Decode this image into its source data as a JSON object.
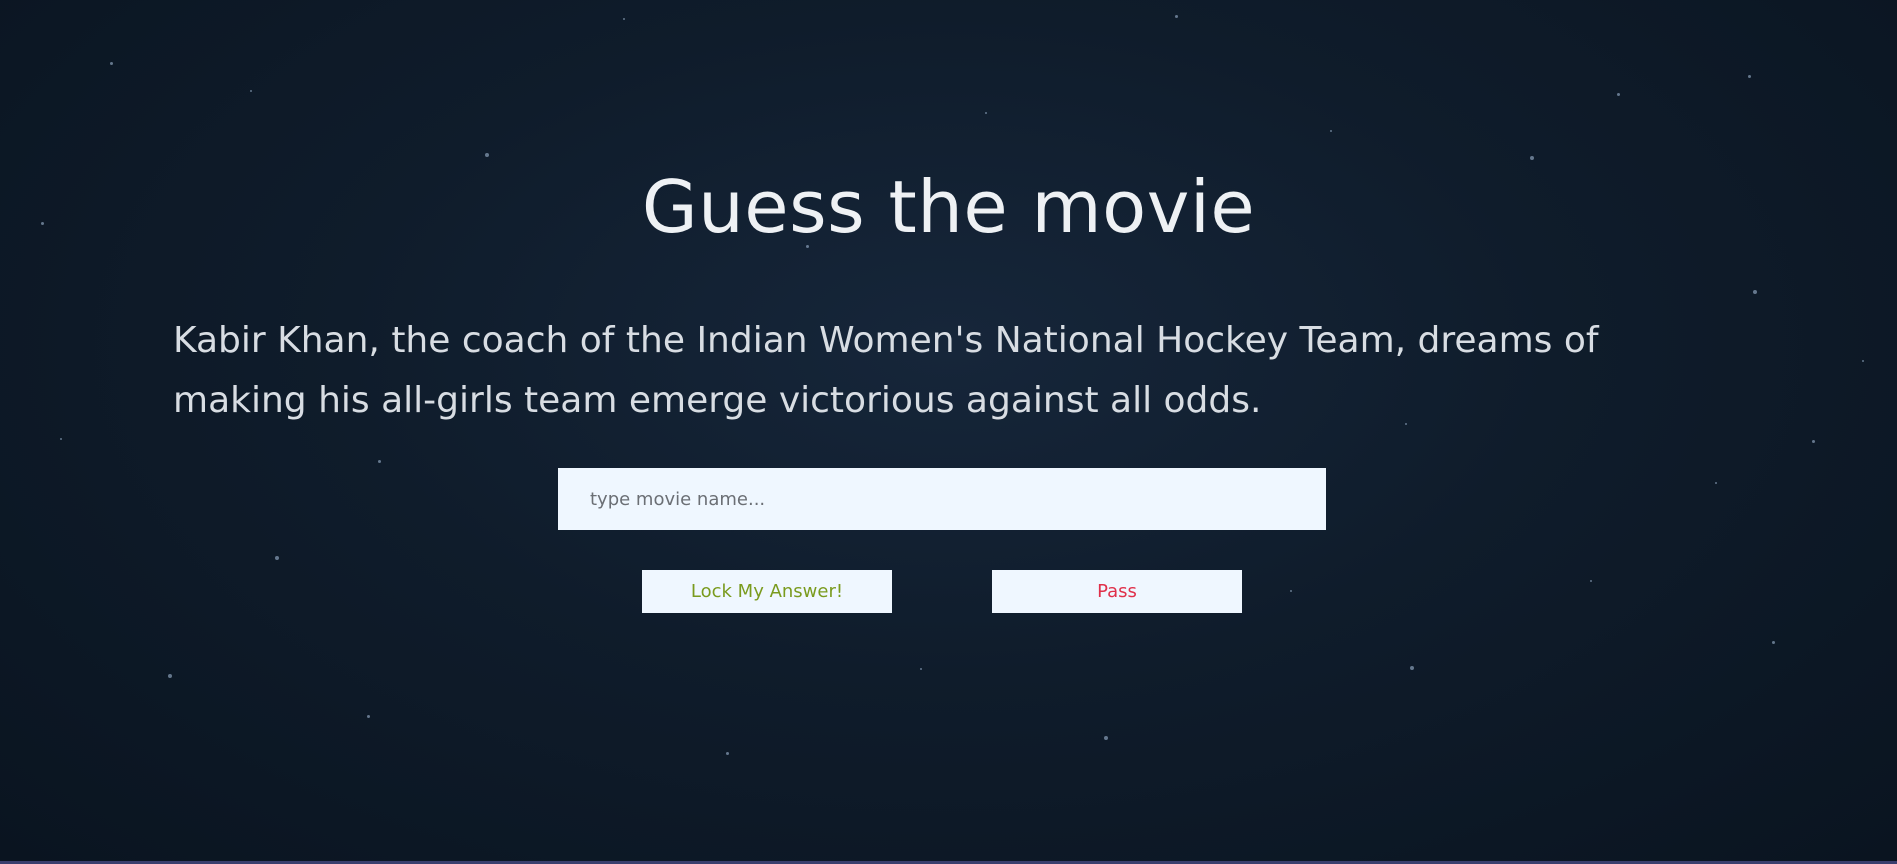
{
  "title": "Guess the movie",
  "clue": "Kabir Khan, the coach of the Indian Women's National Hockey Team, dreams of making his all-girls team emerge victorious against all odds.",
  "answer_input": {
    "value": "",
    "placeholder": "type movie name..."
  },
  "buttons": {
    "lock_label": "Lock My Answer!",
    "pass_label": "Pass"
  },
  "colors": {
    "background": "#0f1c2b",
    "input_bg": "#eff7ff",
    "lock_text": "#7a9b1e",
    "pass_text": "#e0304a"
  }
}
